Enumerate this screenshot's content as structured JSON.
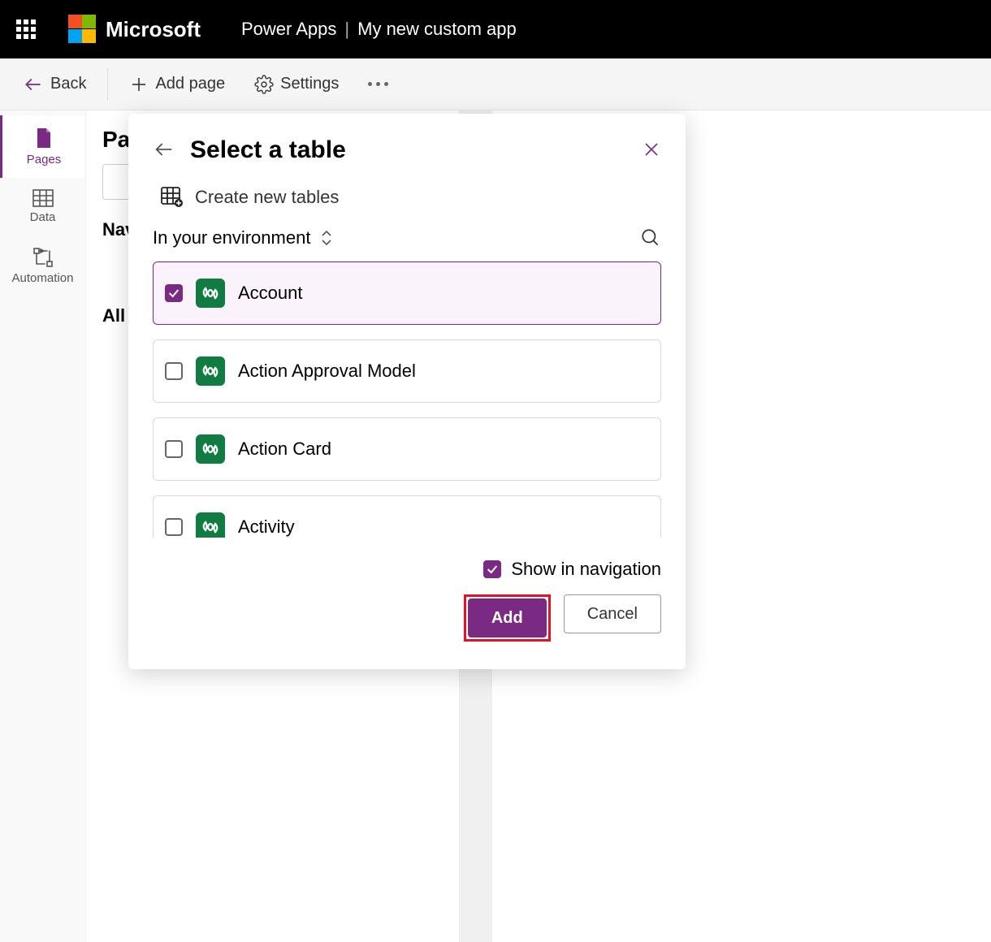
{
  "header": {
    "brand": "Microsoft",
    "app": "Power Apps",
    "app_title": "My new custom app"
  },
  "commandbar": {
    "back": "Back",
    "add_page": "Add page",
    "settings": "Settings"
  },
  "rail": {
    "pages": "Pages",
    "data": "Data",
    "automation": "Automation"
  },
  "content": {
    "heading": "Pages",
    "nav_heading": "Navigation",
    "all_heading": "All other pages"
  },
  "dialog": {
    "title": "Select a table",
    "create_new": "Create new tables",
    "env_label": "In your environment",
    "show_nav": "Show in navigation",
    "add": "Add",
    "cancel": "Cancel",
    "tables": [
      {
        "label": "Account",
        "selected": true
      },
      {
        "label": "Action Approval Model",
        "selected": false
      },
      {
        "label": "Action Card",
        "selected": false
      },
      {
        "label": "Activity",
        "selected": false
      }
    ]
  }
}
